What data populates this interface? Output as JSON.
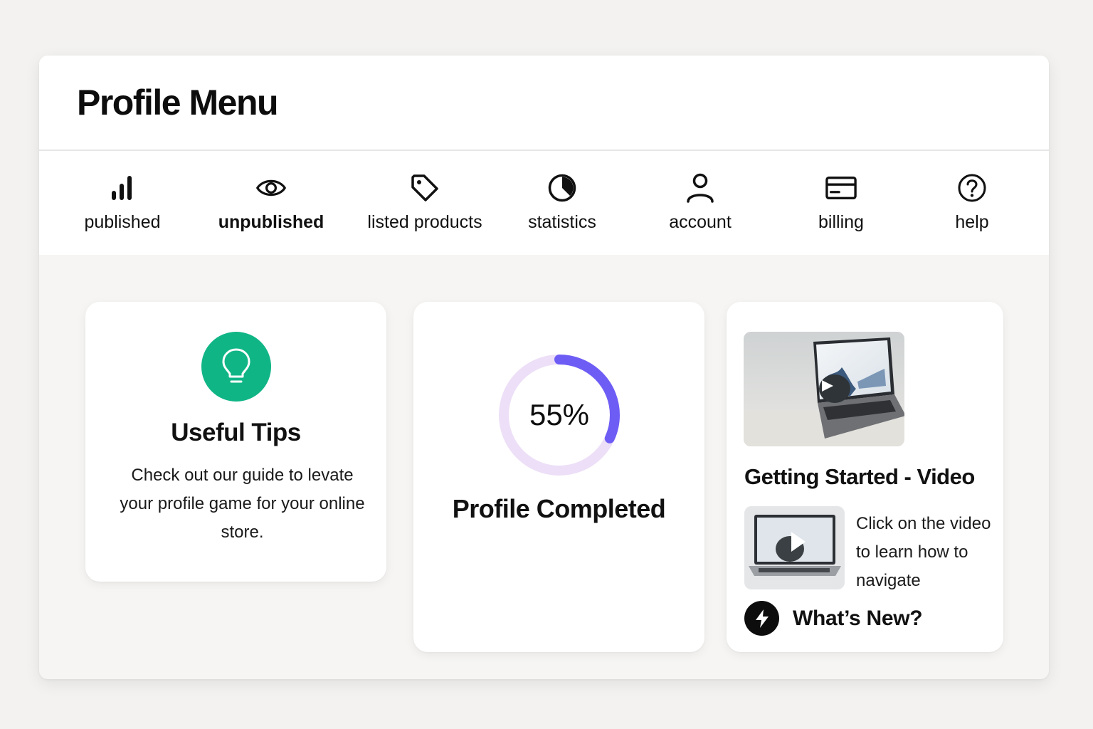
{
  "header": {
    "title": "Profile Menu"
  },
  "nav": {
    "items": [
      {
        "label": "published",
        "icon": "bar-chart-icon"
      },
      {
        "label": "unpublished",
        "icon": "eye-icon",
        "active": true
      },
      {
        "label": "listed products",
        "icon": "tag-icon"
      },
      {
        "label": "statistics",
        "icon": "pie-chart-icon"
      },
      {
        "label": "account",
        "icon": "user-icon"
      },
      {
        "label": "billing",
        "icon": "credit-card-icon"
      },
      {
        "label": "help",
        "icon": "help-circle-icon"
      }
    ]
  },
  "tips": {
    "icon": "lightbulb-icon",
    "title": "Useful Tips",
    "text": "Check out our guide to levate your profile game for your online store."
  },
  "profile_progress": {
    "value_text": "55%",
    "value": 0.55,
    "label": "Profile Completed",
    "colors": {
      "ring": "#6e5df5",
      "track": "#eddff7"
    }
  },
  "video": {
    "title": "Getting Started - Video",
    "description": "Click on the video to learn how to navigate",
    "whats_new_label": "What’s New?",
    "whats_new_icon": "lightning-bolt-icon"
  },
  "colors": {
    "accent_green": "#10b586",
    "accent_purple": "#6e5df5"
  }
}
